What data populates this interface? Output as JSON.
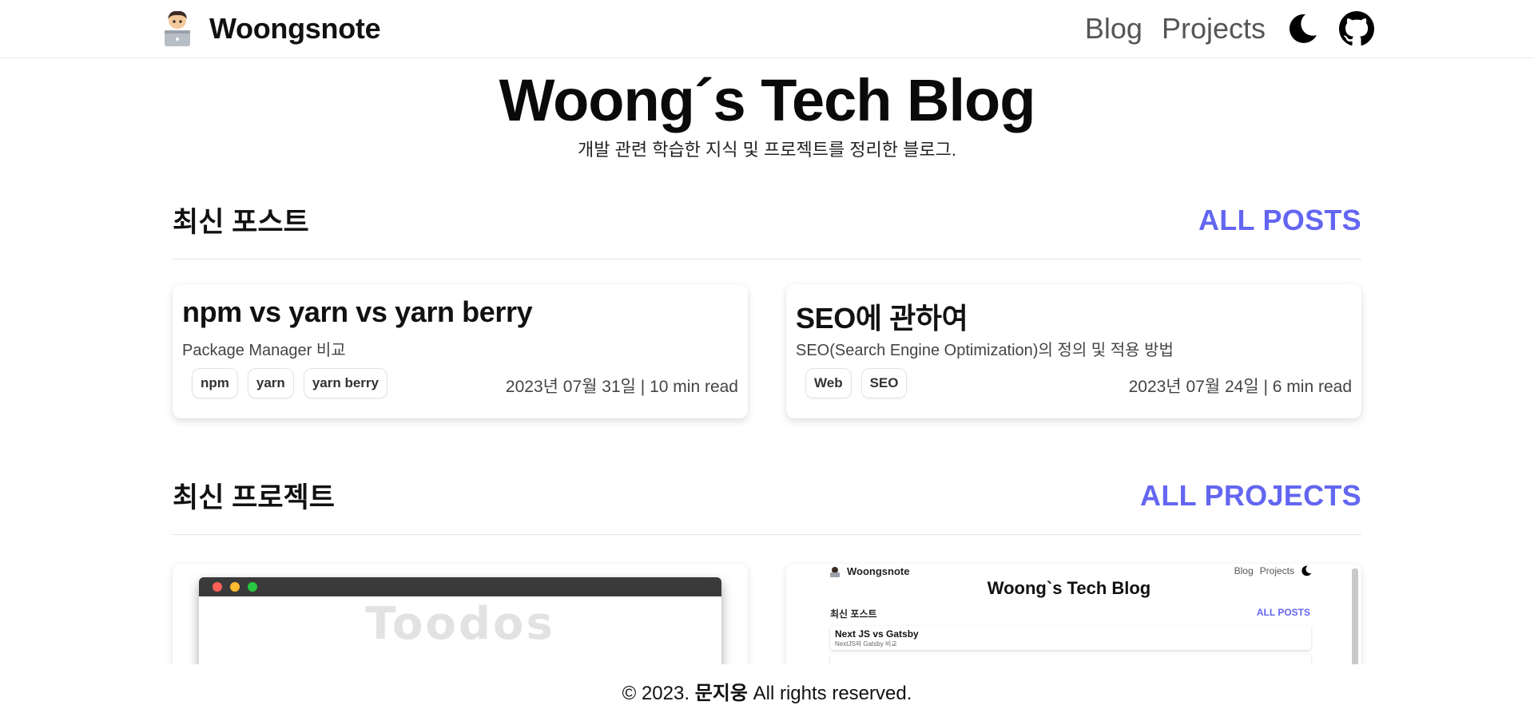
{
  "header": {
    "brand_name": "Woongsnote",
    "nav": {
      "blog": "Blog",
      "projects": "Projects"
    },
    "icons": {
      "theme": "moon-icon",
      "github": "github-icon"
    }
  },
  "hero": {
    "title": "Woong´s Tech Blog",
    "subtitle": "개발 관련 학습한 지식 및 프로젝트를 정리한 블로그."
  },
  "recent_posts": {
    "title": "최신 포스트",
    "link": "ALL POSTS",
    "posts": [
      {
        "title": "npm vs yarn vs yarn berry",
        "description": "Package Manager 비교",
        "tags": [
          "npm",
          "yarn",
          "yarn berry"
        ],
        "meta": "2023년 07월 31일 | 10 min read"
      },
      {
        "title": "SEO에 관하여",
        "description": "SEO(Search Engine Optimization)의 정의 및 적용 방법",
        "tags": [
          "Web",
          "SEO"
        ],
        "meta": "2023년 07월 24일 | 6 min read"
      }
    ]
  },
  "recent_projects": {
    "title": "최신 프로젝트",
    "link": "ALL PROJECTS",
    "projects": [
      {
        "preview_title": "Toodos"
      },
      {
        "preview": {
          "brand": "Woongsnote",
          "nav_blog": "Blog",
          "nav_projects": "Projects",
          "title": "Woong`s Tech Blog",
          "section": "최신 포스트",
          "all_posts": "ALL POSTS",
          "card_title": "Next JS vs Gatsby",
          "card_desc": "NextJS와 Gatsby 비교"
        }
      }
    ]
  },
  "footer": {
    "prefix": "© 2023.",
    "author": "문지웅",
    "suffix": "All rights reserved."
  },
  "colors": {
    "accent": "#6366f1",
    "text": "#111111",
    "muted": "#444444"
  }
}
